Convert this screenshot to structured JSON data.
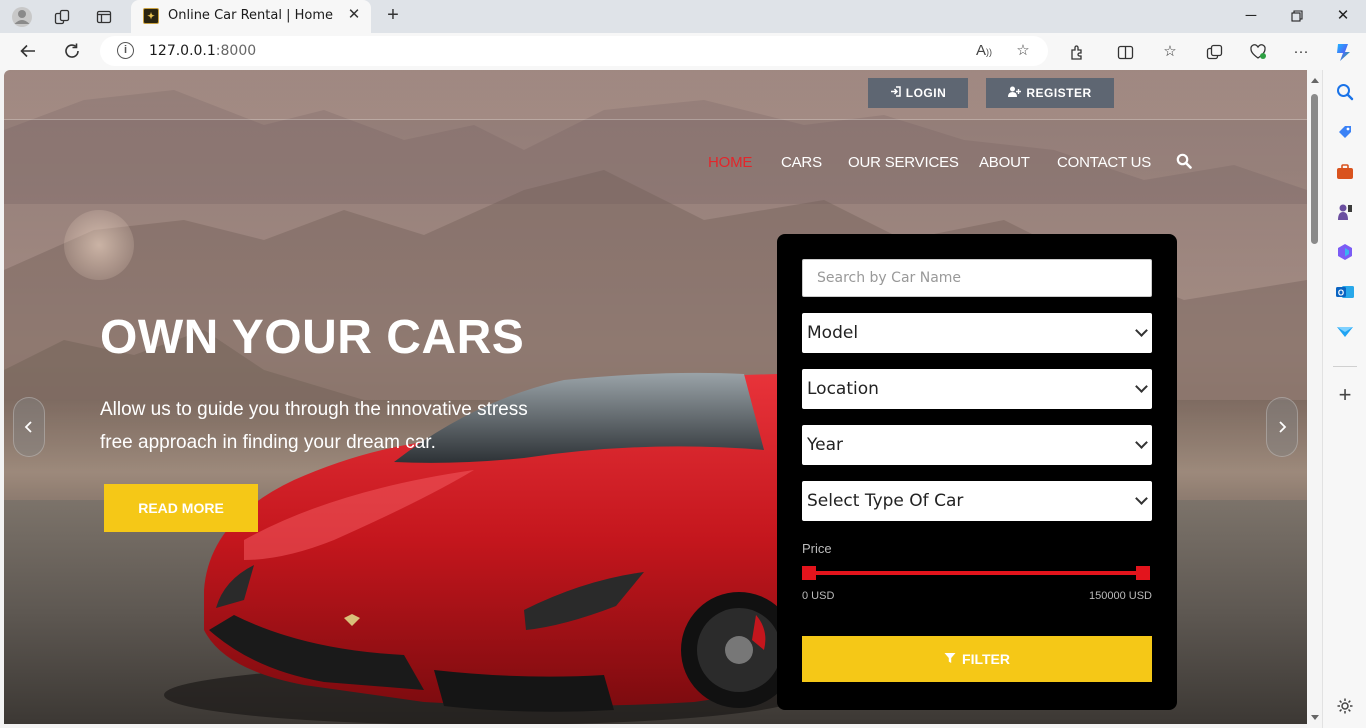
{
  "browser": {
    "tab_title": "Online Car Rental | Home",
    "url_host": "127.0.0.1",
    "url_port": ":8000"
  },
  "auth": {
    "login_label": "LOGIN",
    "register_label": "REGISTER"
  },
  "nav": {
    "items": [
      {
        "label": "HOME",
        "active": true
      },
      {
        "label": "CARS"
      },
      {
        "label": "OUR SERVICES"
      },
      {
        "label": "ABOUT"
      },
      {
        "label": "CONTACT US"
      }
    ]
  },
  "hero": {
    "title": "OWN YOUR CARS",
    "subtitle_line1": "Allow us to guide you through the innovative stress",
    "subtitle_line2": "free approach in finding your dream car.",
    "cta_label": "READ MORE"
  },
  "filter": {
    "search_placeholder": "Search by Car Name",
    "model": "Model",
    "location": "Location",
    "year": "Year",
    "type": "Select Type Of Car",
    "price_label": "Price",
    "price_min": "0 USD",
    "price_max": "150000 USD",
    "button_label": "FILTER"
  },
  "colors": {
    "accent_yellow": "#f5c817",
    "active_red": "#e3262b",
    "slider_red": "#e3141c"
  }
}
